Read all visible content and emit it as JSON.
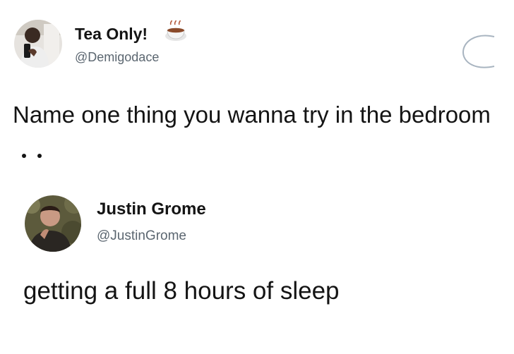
{
  "tweets": [
    {
      "author": {
        "name": "Tea Only!",
        "handle": "@Demigodace",
        "avatar_icon": "avatar-photo-man-selfie",
        "name_emoji": "teacup-icon"
      },
      "text": "Name one thing you wanna try in the bedroom",
      "trailing_icon": "ellipsis-dots-icon",
      "side_icon": "partial-circle-icon"
    },
    {
      "author": {
        "name": "Justin Grome",
        "handle": "@JustinGrome",
        "avatar_icon": "avatar-photo-man-dark-shirt"
      },
      "text": "getting a full 8 hours of sleep"
    }
  ],
  "colors": {
    "background": "#ffffff",
    "text": "#141414",
    "handle": "#5b6670",
    "side_icon": "#a8b4c0"
  }
}
